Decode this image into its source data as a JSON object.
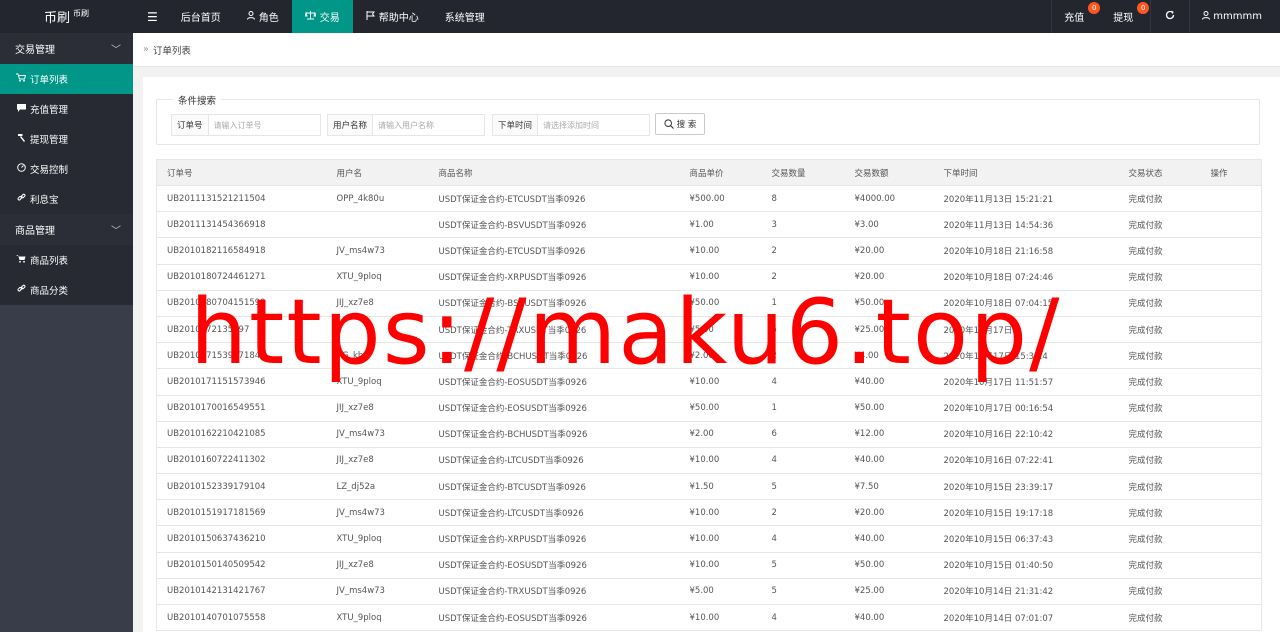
{
  "logo": {
    "main": "币刷",
    "sub": "币刷"
  },
  "topbar": {
    "menu_toggle": "☰",
    "items": [
      {
        "label": "后台首页",
        "icon": ""
      },
      {
        "label": "角色",
        "icon": "user-icon"
      },
      {
        "label": "交易",
        "icon": "scale-icon"
      },
      {
        "label": "帮助中心",
        "icon": "flag-icon"
      },
      {
        "label": "系统管理",
        "icon": ""
      }
    ],
    "recharge": {
      "label": "充值",
      "badge": "0"
    },
    "withdraw": {
      "label": "提现",
      "badge": "0"
    },
    "refresh_icon": "refresh-icon",
    "user": "mmmmm"
  },
  "sidebar": {
    "groups": [
      {
        "title": "交易管理",
        "items": [
          {
            "label": "订单列表",
            "icon": "cart-icon"
          },
          {
            "label": "充值管理",
            "icon": "chat-icon"
          },
          {
            "label": "提现管理",
            "icon": "hammer-icon"
          },
          {
            "label": "交易控制",
            "icon": "gauge-icon"
          },
          {
            "label": "利息宝",
            "icon": "link-icon"
          }
        ]
      },
      {
        "title": "商品管理",
        "items": [
          {
            "label": "商品列表",
            "icon": "cart-icon"
          },
          {
            "label": "商品分类",
            "icon": "link-icon"
          }
        ]
      }
    ]
  },
  "breadcrumb": {
    "sep": "»",
    "current": "订单列表"
  },
  "search": {
    "legend": "条件搜索",
    "order_label": "订单号",
    "order_placeholder": "请输入订单号",
    "user_label": "用户名称",
    "user_placeholder": "请输入用户名称",
    "time_label": "下单时间",
    "time_placeholder": "请选择添加时间",
    "button": "搜 索"
  },
  "table": {
    "headers": [
      "订单号",
      "用户名",
      "商品名称",
      "商品单价",
      "交易数量",
      "交易数额",
      "下单时间",
      "交易状态",
      "操作"
    ],
    "rows": [
      [
        "UB2011131521211504",
        "OPP_4k80u",
        "USDT保证金合约-ETCUSDT当季0926",
        "¥500.00",
        "8",
        "¥4000.00",
        "2020年11月13日 15:21:21",
        "完成付款",
        ""
      ],
      [
        "UB2011131454366918",
        "",
        "USDT保证金合约-BSVUSDT当季0926",
        "¥1.00",
        "3",
        "¥3.00",
        "2020年11月13日 14:54:36",
        "完成付款",
        ""
      ],
      [
        "UB2010182116584918",
        "JV_ms4w73",
        "USDT保证金合约-ETCUSDT当季0926",
        "¥10.00",
        "2",
        "¥20.00",
        "2020年10月18日 21:16:58",
        "完成付款",
        ""
      ],
      [
        "UB2010180724461271",
        "XTU_9ploq",
        "USDT保证金合约-XRPUSDT当季0926",
        "¥10.00",
        "2",
        "¥20.00",
        "2020年10月18日 07:24:46",
        "完成付款",
        ""
      ],
      [
        "UB2010180704151599",
        "JIJ_xz7e8",
        "USDT保证金合约-BSVUSDT当季0926",
        "¥50.00",
        "1",
        "¥50.00",
        "2020年10月18日 07:04:15",
        "完成付款",
        ""
      ],
      [
        "UB2010172135597",
        "",
        "USDT保证金合约-TRXUSDT当季0926",
        "¥5.00",
        "5",
        "¥25.00",
        "2020年10月17日",
        "完成付款",
        ""
      ],
      [
        "UB2010171539471847",
        "AG_kb6",
        "USDT保证金合约-BCHUSDT当季0926",
        "¥2.00",
        "2",
        "¥4.00",
        "2020年10月17日 15:39:4",
        "完成付款",
        ""
      ],
      [
        "UB2010171151573946",
        "XTU_9ploq",
        "USDT保证金合约-EOSUSDT当季0926",
        "¥10.00",
        "4",
        "¥40.00",
        "2020年10月17日 11:51:57",
        "完成付款",
        ""
      ],
      [
        "UB2010170016549551",
        "JIJ_xz7e8",
        "USDT保证金合约-EOSUSDT当季0926",
        "¥50.00",
        "1",
        "¥50.00",
        "2020年10月17日 00:16:54",
        "完成付款",
        ""
      ],
      [
        "UB2010162210421085",
        "JV_ms4w73",
        "USDT保证金合约-BCHUSDT当季0926",
        "¥2.00",
        "6",
        "¥12.00",
        "2020年10月16日 22:10:42",
        "完成付款",
        ""
      ],
      [
        "UB2010160722411302",
        "JIJ_xz7e8",
        "USDT保证金合约-LTCUSDT当季0926",
        "¥10.00",
        "4",
        "¥40.00",
        "2020年10月16日 07:22:41",
        "完成付款",
        ""
      ],
      [
        "UB2010152339179104",
        "LZ_dj52a",
        "USDT保证金合约-BTCUSDT当季0926",
        "¥1.50",
        "5",
        "¥7.50",
        "2020年10月15日 23:39:17",
        "完成付款",
        ""
      ],
      [
        "UB2010151917181569",
        "JV_ms4w73",
        "USDT保证金合约-LTCUSDT当季0926",
        "¥10.00",
        "2",
        "¥20.00",
        "2020年10月15日 19:17:18",
        "完成付款",
        ""
      ],
      [
        "UB2010150637436210",
        "XTU_9ploq",
        "USDT保证金合约-XRPUSDT当季0926",
        "¥10.00",
        "4",
        "¥40.00",
        "2020年10月15日 06:37:43",
        "完成付款",
        ""
      ],
      [
        "UB2010150140509542",
        "JIJ_xz7e8",
        "USDT保证金合约-EOSUSDT当季0926",
        "¥10.00",
        "5",
        "¥50.00",
        "2020年10月15日 01:40:50",
        "完成付款",
        ""
      ],
      [
        "UB2010142131421767",
        "JV_ms4w73",
        "USDT保证金合约-TRXUSDT当季0926",
        "¥5.00",
        "5",
        "¥25.00",
        "2020年10月14日 21:31:42",
        "完成付款",
        ""
      ],
      [
        "UB2010140701075558",
        "XTU_9ploq",
        "USDT保证金合约-EOSUSDT当季0926",
        "¥10.00",
        "4",
        "¥40.00",
        "2020年10月14日 07:01:07",
        "完成付款",
        ""
      ]
    ]
  },
  "watermark": "https://maku6.top/",
  "colors": {
    "accent": "#009688",
    "topbar": "#23262e",
    "sidebar": "#393d49",
    "badge": "#ff5722",
    "watermark": "#ff0000"
  }
}
